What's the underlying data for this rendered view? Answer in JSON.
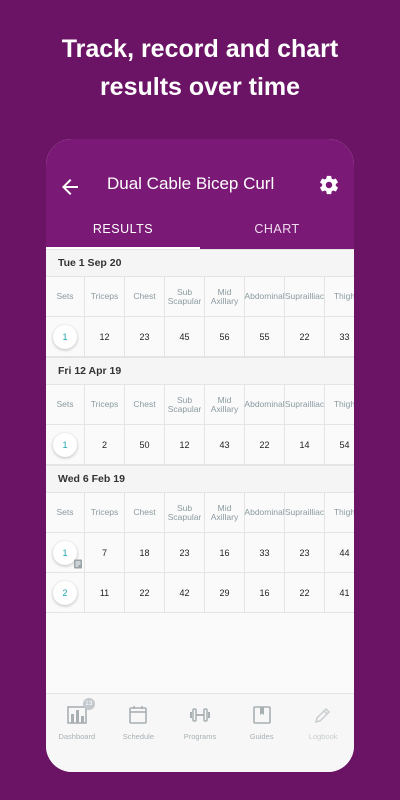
{
  "headline": {
    "line1": "Track, record and chart",
    "line2": "results over time"
  },
  "app_bar": {
    "title": "Dual Cable Bicep Curl"
  },
  "tabs": [
    {
      "label": "RESULTS"
    },
    {
      "label": "CHART"
    }
  ],
  "columns": {
    "sets": "Sets",
    "labels": [
      [
        "Triceps"
      ],
      [
        "Chest"
      ],
      [
        "Sub",
        "Scapular"
      ],
      [
        "Mid",
        "Axillary"
      ],
      [
        "Abdominal"
      ],
      [
        "Suprailliac"
      ],
      [
        "Thigh"
      ]
    ]
  },
  "sessions": [
    {
      "date": "Tue 1 Sep 20",
      "rows": [
        {
          "set": "1",
          "values": [
            "12",
            "23",
            "45",
            "56",
            "55",
            "22",
            "33"
          ],
          "note": false
        }
      ]
    },
    {
      "date": "Fri 12 Apr 19",
      "rows": [
        {
          "set": "1",
          "values": [
            "2",
            "50",
            "12",
            "43",
            "22",
            "14",
            "54"
          ],
          "note": false
        }
      ]
    },
    {
      "date": "Wed 6 Feb 19",
      "rows": [
        {
          "set": "1",
          "values": [
            "7",
            "18",
            "23",
            "16",
            "33",
            "23",
            "44"
          ],
          "note": true
        },
        {
          "set": "2",
          "values": [
            "11",
            "22",
            "42",
            "29",
            "16",
            "22",
            "41"
          ],
          "note": false
        }
      ]
    }
  ],
  "bottom_nav": [
    {
      "label": "Dashboard",
      "icon": "bar-chart-icon",
      "badge": "13"
    },
    {
      "label": "Schedule",
      "icon": "calendar-icon"
    },
    {
      "label": "Programs",
      "icon": "dumbbell-icon"
    },
    {
      "label": "Guides",
      "icon": "bookmark-book-icon"
    },
    {
      "label": "Logbook",
      "icon": "pencil-icon",
      "disabled": true
    }
  ],
  "colors": {
    "background": "#6b1466",
    "app_bar": "#7b1a76",
    "accent": "#19a2ad"
  }
}
